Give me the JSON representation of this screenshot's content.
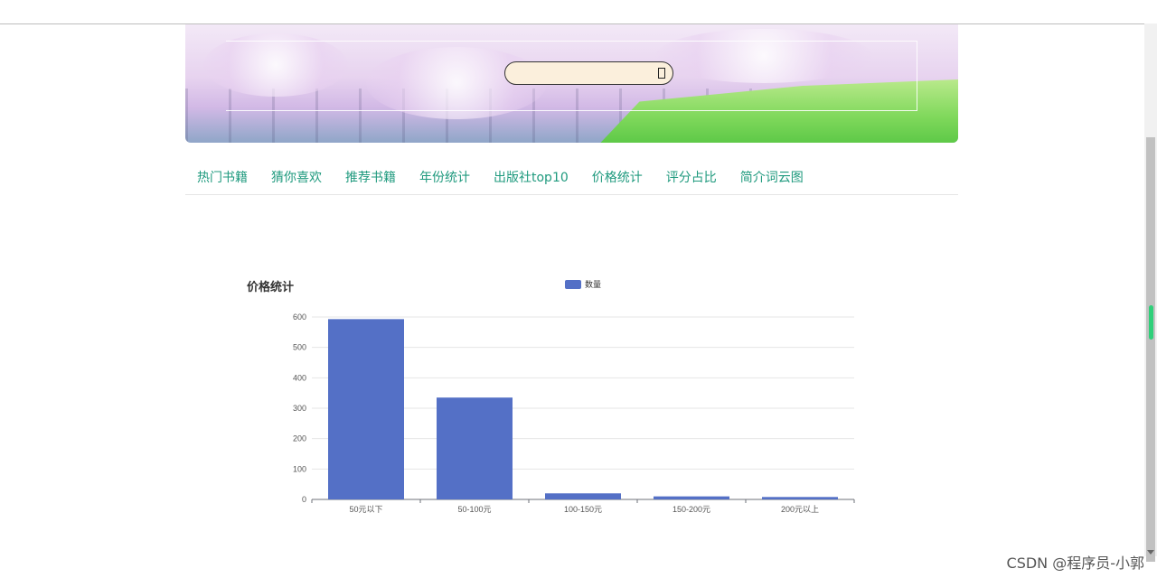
{
  "banner": {
    "site_title": "",
    "search_placeholder": ""
  },
  "nav": {
    "items": [
      "热门书籍",
      "猜你喜欢",
      "推荐书籍",
      "年份统计",
      "出版社top10",
      "价格统计",
      "评分占比",
      "简介词云图"
    ]
  },
  "chart_title": "价格统计",
  "chart_data": {
    "type": "bar",
    "title": "价格统计",
    "categories": [
      "50元以下",
      "50-100元",
      "100-150元",
      "150-200元",
      "200元以上"
    ],
    "series": [
      {
        "name": "数量",
        "values": [
          593,
          335,
          20,
          10,
          8
        ],
        "color": "#5470c6"
      }
    ],
    "ylim": [
      0,
      600
    ],
    "yticks": [
      0,
      100,
      200,
      300,
      400,
      500,
      600
    ],
    "grid": true,
    "legend": "top-center"
  },
  "watermark": "CSDN @程序员-小郭"
}
